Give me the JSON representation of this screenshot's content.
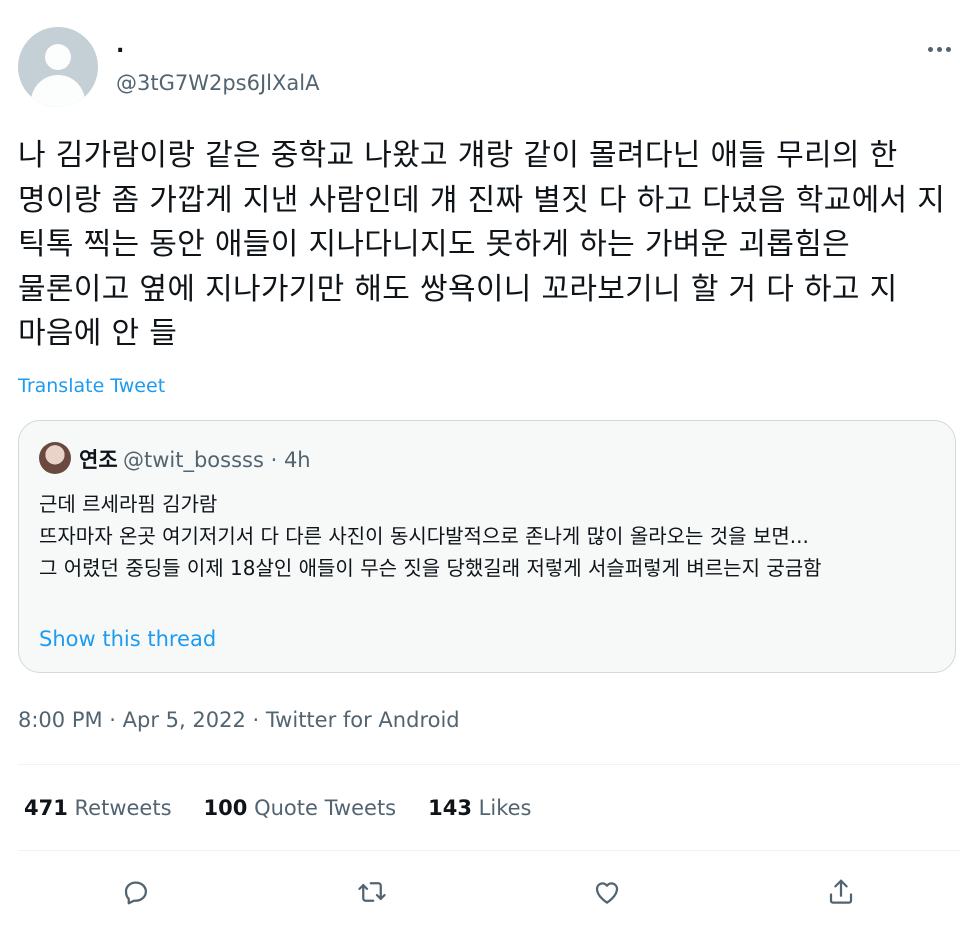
{
  "author": {
    "display_name": ".",
    "handle": "@3tG7W2ps6JlXalA"
  },
  "tweet": {
    "text": "나 김가람이랑 같은 중학교 나왔고 걔랑 같이 몰려다닌 애들 무리의 한 명이랑 좀 가깝게 지낸 사람인데 걔 진짜 별짓 다 하고 다녔음 학교에서 지 틱톡 찍는 동안 애들이 지나다니지도 못하게 하는 가벼운 괴롭힘은 물론이고 옆에 지나가기만 해도 쌍욕이니 꼬라보기니 할 거 다 하고 지 마음에 안 들",
    "translate_label": "Translate Tweet",
    "meta": "8:00 PM · Apr 5, 2022 · Twitter for Android"
  },
  "quote": {
    "name": "연조",
    "handle_time": "@twit_bossss · 4h",
    "line1": "근데 르세라핌 김가람",
    "line2": "뜨자마자 온곳 여기저기서 다 다른 사진이 동시다발적으로 존나게 많이 올라오는 것을 보면...",
    "line3": "그 어렸던 중딩들 이제 18살인 애들이 무슨 짓을 당했길래 저렇게 서슬퍼렇게 벼르는지 궁금함",
    "show_thread": "Show this thread"
  },
  "stats": {
    "retweets_count": "471",
    "retweets_label": "Retweets",
    "quotes_count": "100",
    "quotes_label": "Quote Tweets",
    "likes_count": "143",
    "likes_label": "Likes"
  },
  "icons": [
    "reply-icon",
    "retweet-icon",
    "like-icon",
    "share-icon"
  ],
  "colors": {
    "accent": "#1d9bf0",
    "secondary_text": "#536471",
    "border": "#cfd9de"
  }
}
